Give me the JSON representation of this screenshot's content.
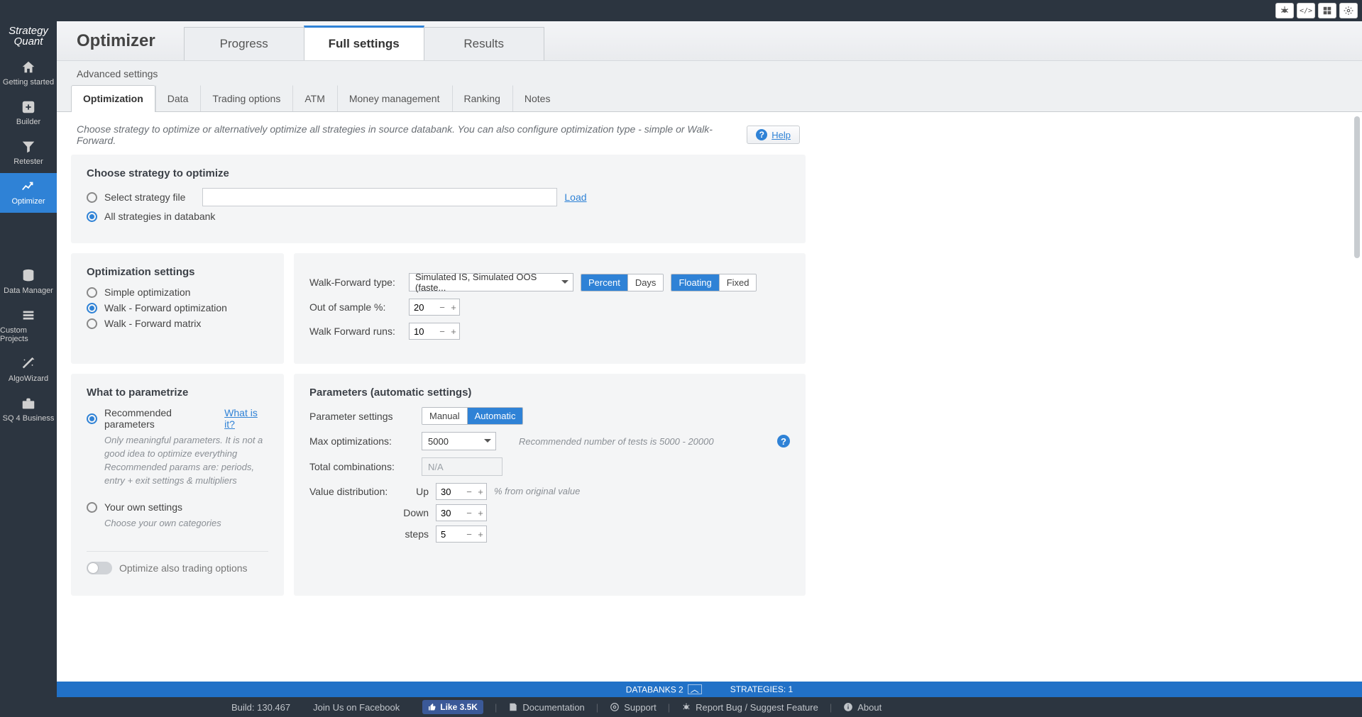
{
  "logo": {
    "line1": "Strategy",
    "line2": "Quant"
  },
  "sidebar": [
    {
      "name": "getting-started",
      "label": "Getting started",
      "icon": "home"
    },
    {
      "name": "builder",
      "label": "Builder",
      "icon": "plus"
    },
    {
      "name": "retester",
      "label": "Retester",
      "icon": "funnel"
    },
    {
      "name": "optimizer",
      "label": "Optimizer",
      "icon": "chart",
      "active": true
    },
    {
      "name": "data-manager",
      "label": "Data Manager",
      "icon": "database"
    },
    {
      "name": "custom-projects",
      "label": "Custom Projects",
      "icon": "stack"
    },
    {
      "name": "algowizard",
      "label": "AlgoWizard",
      "icon": "wand"
    },
    {
      "name": "sq4business",
      "label": "SQ 4 Business",
      "icon": "briefcase"
    }
  ],
  "page_title": "Optimizer",
  "tabs": [
    {
      "label": "Progress"
    },
    {
      "label": "Full settings",
      "active": true
    },
    {
      "label": "Results"
    }
  ],
  "subheading": "Advanced settings",
  "sub_tabs": [
    {
      "label": "Optimization",
      "active": true
    },
    {
      "label": "Data"
    },
    {
      "label": "Trading options"
    },
    {
      "label": "ATM"
    },
    {
      "label": "Money management"
    },
    {
      "label": "Ranking"
    },
    {
      "label": "Notes"
    }
  ],
  "intro_text": "Choose strategy to optimize or alternatively optimize all strategies in source databank. You can also configure optimization type - simple or Walk-Forward.",
  "help_label": "Help",
  "choose_strategy": {
    "title": "Choose strategy to optimize",
    "opt_file": "Select strategy file",
    "load": "Load",
    "opt_all": "All strategies in databank"
  },
  "opt_settings": {
    "title": "Optimization settings",
    "simple": "Simple optimization",
    "wf": "Walk - Forward optimization",
    "wfm": "Walk - Forward matrix"
  },
  "wf_panel": {
    "type_label": "Walk-Forward type:",
    "type_value": "Simulated IS, Simulated OOS (faste...",
    "percent": "Percent",
    "days": "Days",
    "floating": "Floating",
    "fixed": "Fixed",
    "oos_label": "Out of sample %:",
    "oos_value": "20",
    "runs_label": "Walk Forward runs:",
    "runs_value": "10"
  },
  "parametrize": {
    "title": "What to parametrize",
    "rec_label": "Recommended parameters",
    "what_is_it": "What is it?",
    "rec_desc": "Only meaningful parameters. It is not a good idea to optimize everything Recommended params are: periods, entry + exit settings & multipliers",
    "own_label": "Your own settings",
    "own_desc": "Choose your own categories",
    "toggle_label": "Optimize also trading options"
  },
  "params": {
    "title": "Parameters (automatic settings)",
    "settings_label": "Parameter settings",
    "manual": "Manual",
    "automatic": "Automatic",
    "max_label": "Max optimizations:",
    "max_value": "5000",
    "max_hint": "Recommended number of tests is 5000 - 20000",
    "total_label": "Total combinations:",
    "total_value": "N/A",
    "dist_label": "Value distribution:",
    "up_label": "Up",
    "up_value": "30",
    "down_label": "Down",
    "down_value": "30",
    "steps_label": "steps",
    "steps_value": "5",
    "pct_hint": "% from original value"
  },
  "databanks": {
    "left": "DATABANKS 2",
    "right": "STRATEGIES: 1"
  },
  "footer": {
    "build": "Build: 130.467",
    "join": "Join Us on Facebook",
    "like": "Like 3.5K",
    "doc": "Documentation",
    "support": "Support",
    "report": "Report Bug / Suggest Feature",
    "about": "About"
  }
}
